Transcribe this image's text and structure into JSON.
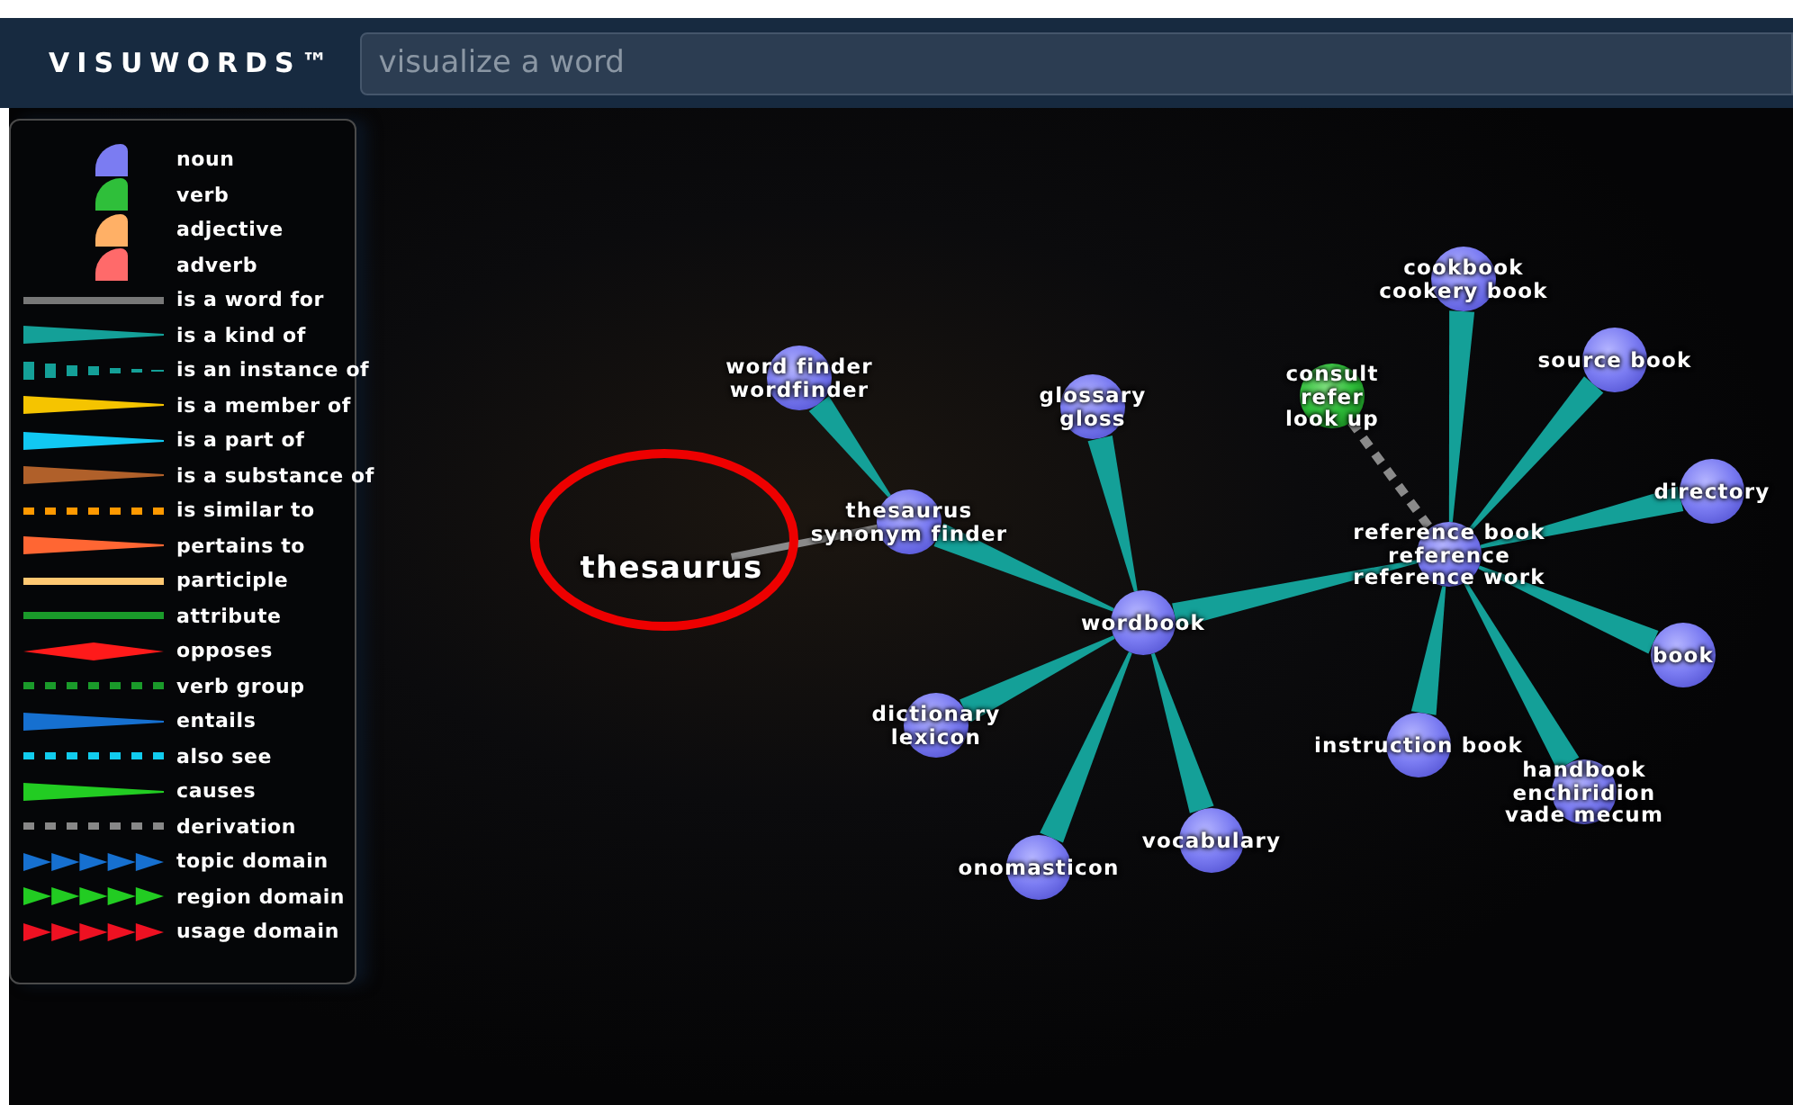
{
  "header": {
    "logo": "VISUWORDS™",
    "search": {
      "placeholder": "visualize a word"
    }
  },
  "legend": [
    {
      "label": "noun",
      "kind": "pos",
      "color": "#7b7cf2"
    },
    {
      "label": "verb",
      "kind": "pos",
      "color": "#2fbf3a"
    },
    {
      "label": "adjective",
      "kind": "pos",
      "color": "#ffb066"
    },
    {
      "label": "adverb",
      "kind": "pos",
      "color": "#ff6a6a"
    },
    {
      "label": "is a word for",
      "kind": "line",
      "color": "#777777"
    },
    {
      "label": "is a kind of",
      "kind": "taper",
      "color": "#14a098"
    },
    {
      "label": "is an instance of",
      "kind": "dashtaper",
      "color": "#14a098"
    },
    {
      "label": "is a member of",
      "kind": "taper",
      "color": "#f5c400"
    },
    {
      "label": "is a part of",
      "kind": "taper",
      "color": "#11c8f2"
    },
    {
      "label": "is a substance of",
      "kind": "taper",
      "color": "#b0602a"
    },
    {
      "label": "is similar to",
      "kind": "dashes",
      "color": "#ff9900"
    },
    {
      "label": "pertains to",
      "kind": "taper",
      "color": "#ff6633"
    },
    {
      "label": "participle",
      "kind": "line",
      "color": "#ffc872"
    },
    {
      "label": "attribute",
      "kind": "line",
      "color": "#1a9a2a"
    },
    {
      "label": "opposes",
      "kind": "diamond",
      "color": "#ff1a1a"
    },
    {
      "label": "verb group",
      "kind": "dashes",
      "color": "#1a9a2a"
    },
    {
      "label": "entails",
      "kind": "taper",
      "color": "#1670d0"
    },
    {
      "label": "also see",
      "kind": "dashes",
      "color": "#11ccee"
    },
    {
      "label": "causes",
      "kind": "taper",
      "color": "#22cc22"
    },
    {
      "label": "derivation",
      "kind": "dashes",
      "color": "#888888"
    },
    {
      "label": "topic domain",
      "kind": "arrows",
      "color": "#1670d0"
    },
    {
      "label": "region domain",
      "kind": "arrows",
      "color": "#22cc22"
    },
    {
      "label": "usage domain",
      "kind": "arrows",
      "color": "#ee1122"
    }
  ],
  "graph": {
    "nodes": [
      {
        "kind": "headword",
        "lines": [
          "thesaurus"
        ]
      },
      {
        "kind": "noun",
        "lines": [
          "thesaurus",
          "synonym finder"
        ]
      },
      {
        "kind": "noun",
        "lines": [
          "word finder",
          "wordfinder"
        ]
      },
      {
        "kind": "noun",
        "lines": [
          "glossary",
          "gloss"
        ]
      },
      {
        "kind": "noun",
        "lines": [
          "wordbook"
        ]
      },
      {
        "kind": "noun",
        "lines": [
          "dictionary",
          "lexicon"
        ]
      },
      {
        "kind": "noun",
        "lines": [
          "onomasticon"
        ]
      },
      {
        "kind": "noun",
        "lines": [
          "vocabulary"
        ]
      },
      {
        "kind": "noun",
        "lines": [
          "reference book",
          "reference",
          "reference work"
        ]
      },
      {
        "kind": "verb",
        "lines": [
          "consult",
          "refer",
          "look up"
        ]
      },
      {
        "kind": "noun",
        "lines": [
          "cookbook",
          "cookery book"
        ]
      },
      {
        "kind": "noun",
        "lines": [
          "source book"
        ]
      },
      {
        "kind": "noun",
        "lines": [
          "directory"
        ]
      },
      {
        "kind": "noun",
        "lines": [
          "book"
        ]
      },
      {
        "kind": "noun",
        "lines": [
          "instruction book"
        ]
      },
      {
        "kind": "noun",
        "lines": [
          "handbook",
          "enchiridion",
          "vade mecum"
        ]
      }
    ]
  }
}
